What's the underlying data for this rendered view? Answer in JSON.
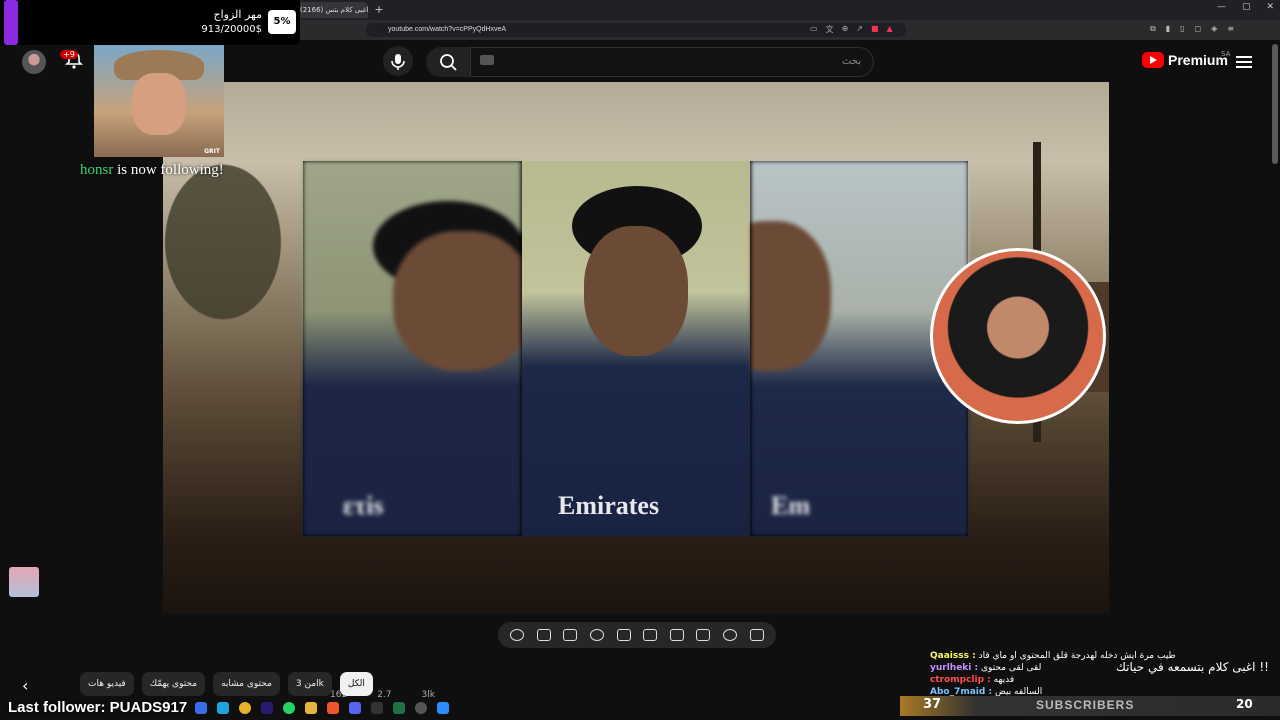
{
  "browser": {
    "tab_title": "(2166) اغبى كلام بتس",
    "url": "youtube.com/watch?v=cPPyQdHxveA"
  },
  "donation": {
    "title": "مهر الزواج",
    "amount": "913/20000$",
    "percent": "5%",
    "progress_fraction": 0.05
  },
  "youtube": {
    "brand": "Premium",
    "region": "SA",
    "search_placeholder": "بحث",
    "notification_count": "+9"
  },
  "webcam": {
    "tag": "GRIT"
  },
  "alert": {
    "follower_name": "honsr",
    "text": " is now following!"
  },
  "chips": [
    {
      "label": "الكل",
      "active": true
    },
    {
      "label": "من 3lk",
      "active": false
    },
    {
      "label": "محتوى مشابه",
      "active": false
    },
    {
      "label": "محتوى يهمّك",
      "active": false
    },
    {
      "label": "فيديو هات",
      "active": false
    }
  ],
  "chat": {
    "overlay_line": "اغبى كلام بتسمعه في حياتك !!",
    "messages": [
      {
        "user": "Qaaisss :",
        "text": "طيب مرة ايش دخله لهدرجة قلق المحتوى او ماي قاد",
        "style": ""
      },
      {
        "user": "yurlheki :",
        "text": "لقى لقى محتوى",
        "style": "purple"
      },
      {
        "user": "ctrompclip :",
        "text": "فديهه",
        "style": "red"
      },
      {
        "user": "Abo_7maid :",
        "text": "السالفه بيض",
        "style": "blue"
      }
    ]
  },
  "subs": {
    "count": "37",
    "label": "SUBSCRIBERS",
    "goal": "20"
  },
  "last_follower": {
    "label": "Last follower: PUADS917"
  },
  "stats": [
    "162",
    "2.7",
    "3lk"
  ],
  "colors": {
    "youtube_red": "#ff0000",
    "accent_purple": "#8a2be2",
    "follow_green": "#3bd671"
  }
}
